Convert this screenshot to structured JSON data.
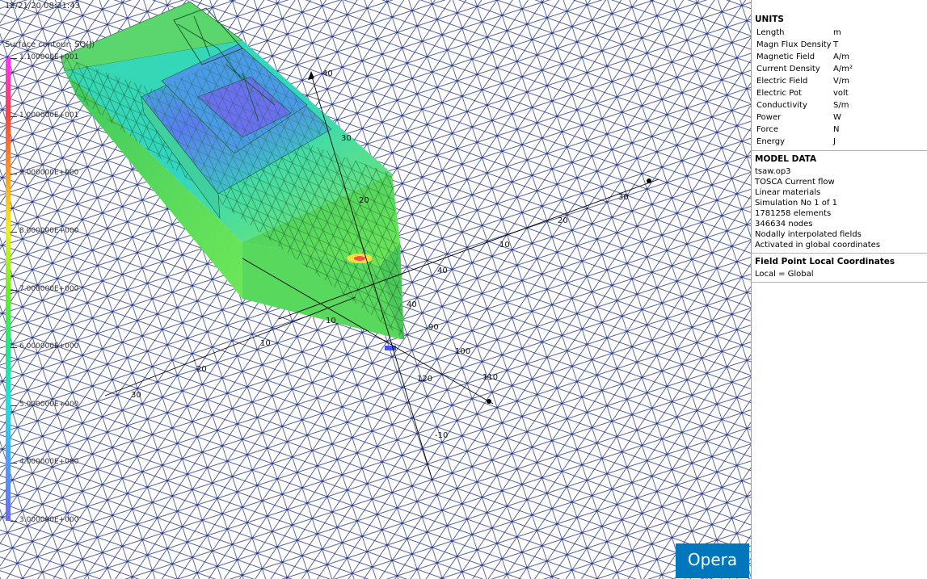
{
  "viewport": {
    "timestamp": "12/21/20 08:31:43",
    "legend_title": "Surface contour: SQ(J)",
    "legend_values": [
      "1.100000E+001",
      "1.000000E+001",
      "9.000000E+000",
      "8.000000E+000",
      "7.000000E+000",
      "6.000000E+000",
      "5.000000E+000",
      "4.000000E+000",
      "3.000000E+000"
    ],
    "legend_colors": [
      "#ff33ff",
      "#ff4040",
      "#ff9a20",
      "#f0f020",
      "#70ee20",
      "#20e880",
      "#20e0e0",
      "#4aa0ff",
      "#6a6aff"
    ],
    "axis_labels": [
      "40",
      "30",
      "20",
      "10",
      "10",
      "20",
      "30",
      "40",
      "10",
      "20",
      "30",
      "40",
      "90",
      "100",
      "110",
      "120",
      "-10",
      "-20"
    ],
    "brand": "Opera",
    "colors": {
      "mesh": "#1a2a7a",
      "brand": "#0077bd"
    }
  },
  "units": {
    "title": "UNITS",
    "rows": [
      {
        "label": "Length",
        "value": "m"
      },
      {
        "label": "Magn Flux Density",
        "value": "T"
      },
      {
        "label": "Magnetic Field",
        "value": "A/m"
      },
      {
        "label": "Current Density",
        "value": "A/m²"
      },
      {
        "label": "Electric Field",
        "value": "V/m"
      },
      {
        "label": "Electric Pot",
        "value": "volt"
      },
      {
        "label": "Conductivity",
        "value": "S/m"
      },
      {
        "label": "Power",
        "value": "W"
      },
      {
        "label": "Force",
        "value": "N"
      },
      {
        "label": "Energy",
        "value": "J"
      }
    ]
  },
  "model": {
    "title": "MODEL DATA",
    "lines": [
      "tsaw.op3",
      "TOSCA Current flow",
      "Linear materials",
      "Simulation No 1 of 1",
      "1781258 elements",
      "346634 nodes",
      "Nodally interpolated fields",
      "Activated in global coordinates"
    ]
  },
  "field_point": {
    "title": "Field Point Local Coordinates",
    "line": "Local = Global"
  }
}
